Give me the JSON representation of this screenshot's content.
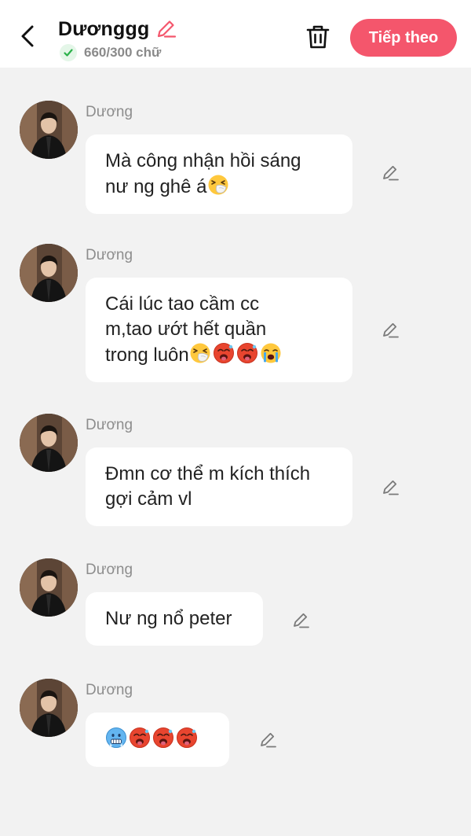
{
  "header": {
    "title": "Dươnggg",
    "char_count": "660/300 chữ",
    "next_label": "Tiếp theo",
    "accent_color": "#f4566c",
    "check_color": "#2bb14a"
  },
  "messages": [
    {
      "sender": "Dương",
      "lines": [
        "Mà công nhận hồi sáng",
        "nư ng ghê á"
      ],
      "emojis": [
        "sneezing-face"
      ]
    },
    {
      "sender": "Dương",
      "lines": [
        "Cái lúc tao cầm cc",
        "m,tao ướt hết quần",
        "trong luôn"
      ],
      "emojis": [
        "sneezing-face",
        "hot-face",
        "hot-face",
        "crying-face"
      ]
    },
    {
      "sender": "Dương",
      "lines": [
        "Đmn cơ thể m kích thích",
        "gợi cảm vl"
      ],
      "emojis": []
    },
    {
      "sender": "Dương",
      "lines": [
        "Nư ng nổ peter"
      ],
      "emojis": []
    },
    {
      "sender": "Dương",
      "lines": [
        ""
      ],
      "emojis": [
        "cold-face",
        "hot-face",
        "hot-face",
        "hot-face"
      ]
    }
  ]
}
